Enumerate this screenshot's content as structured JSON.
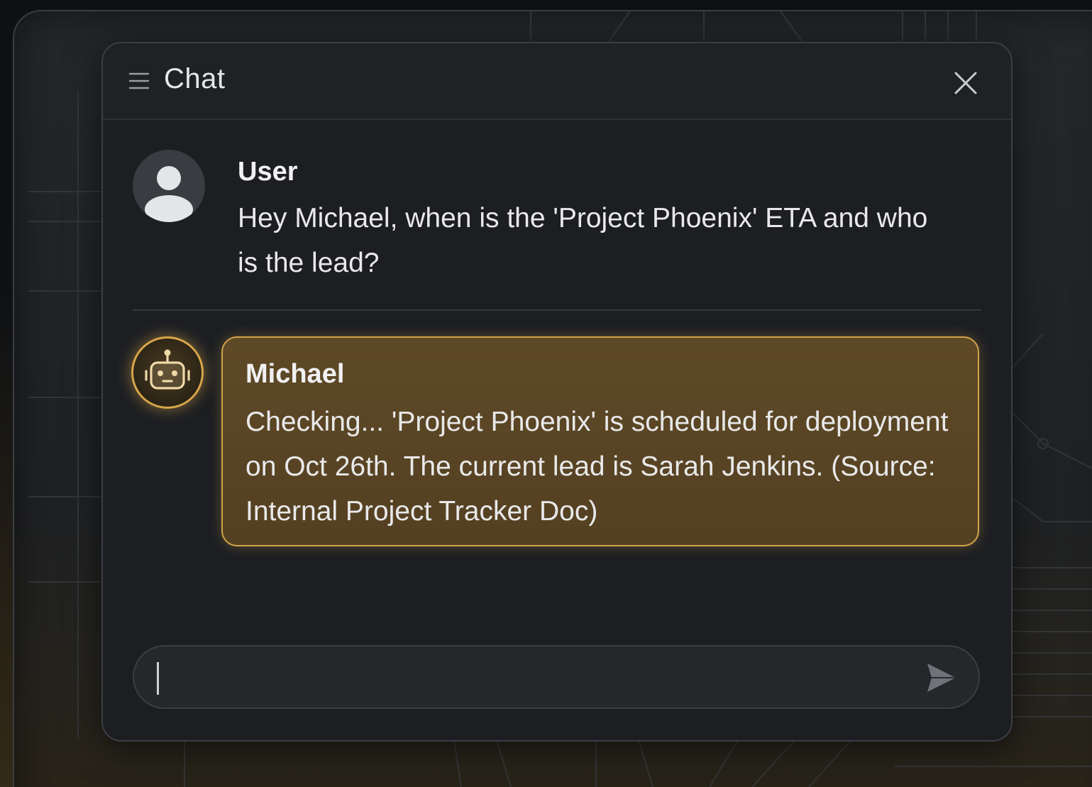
{
  "window": {
    "title": "Chat",
    "menu_icon": "hamburger-menu-icon",
    "close_icon": "close-icon"
  },
  "messages": [
    {
      "sender": "User",
      "avatar_icon": "user-avatar-icon",
      "text": "Hey Michael, when is the 'Project Phoenix' ETA and who is the lead?"
    },
    {
      "sender": "Michael",
      "avatar_icon": "robot-icon",
      "text": "Checking... 'Project Phoenix' is scheduled for deployment on Oct 26th. The current lead is Sarah Jenkins. (Source: Internal Project Tracker Doc)"
    }
  ],
  "composer": {
    "value": "",
    "placeholder": "",
    "send_icon": "send-icon"
  },
  "colors": {
    "accent": "#d4a24a",
    "window_bg": "#1c1e22",
    "text": "#e9e9ea"
  }
}
